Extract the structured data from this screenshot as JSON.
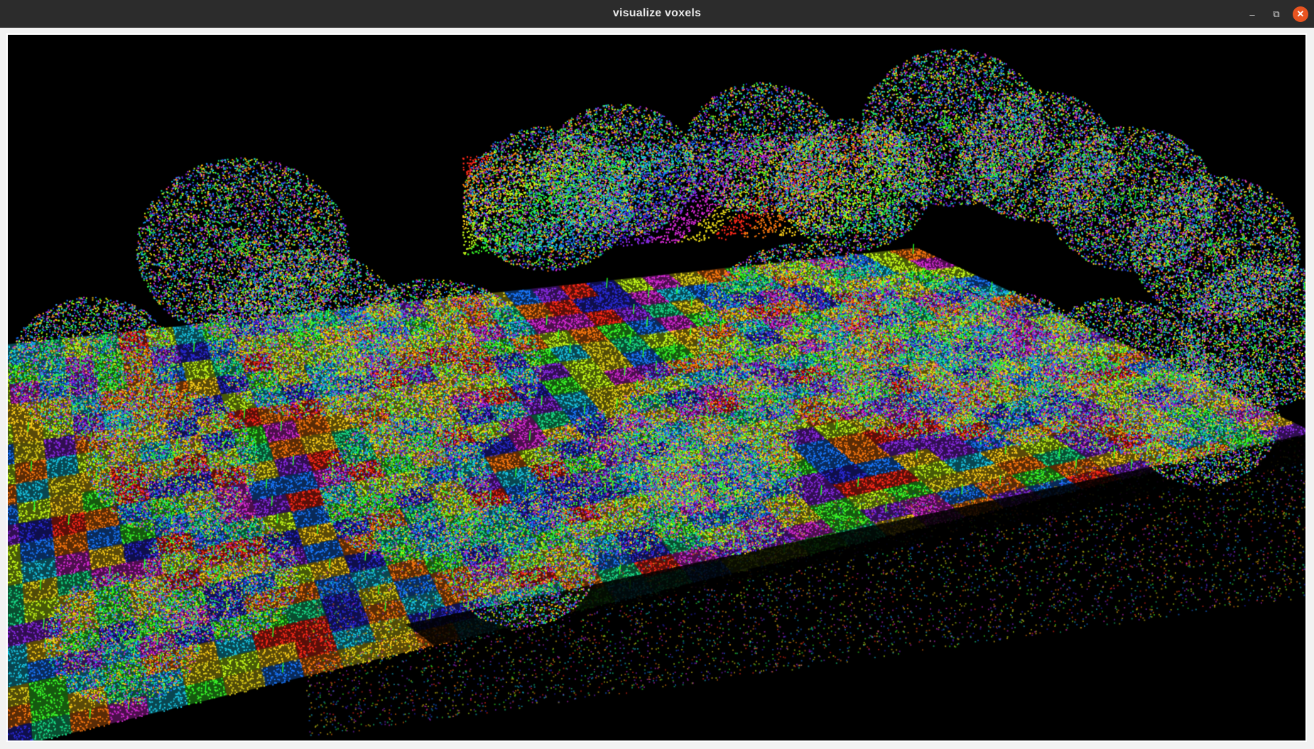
{
  "window": {
    "title": "visualize voxels",
    "controls": {
      "minimize_icon": "minimize-icon",
      "maximize_icon": "restore-icon",
      "close_icon": "close-icon"
    },
    "colors": {
      "titlebar": "#2c2c2c",
      "close_button": "#e95420",
      "viewport_background": "#000000"
    }
  },
  "viewport": {
    "content": "point-cloud-voxel-visualization",
    "palette": [
      "#ff2a1a",
      "#ff7a10",
      "#ffd21a",
      "#c8ff1a",
      "#3cff2a",
      "#19e08a",
      "#19c8e6",
      "#1a78ff",
      "#2a2ad8",
      "#8a2ae6",
      "#d62ad6",
      "#e6d61a"
    ],
    "normal_line_color": "#28ff28"
  }
}
